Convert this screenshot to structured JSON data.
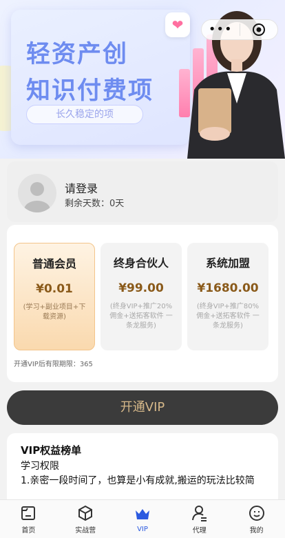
{
  "banner": {
    "line1": "轻资产创",
    "line2": "知识付费项",
    "pill": "长久稳定的项",
    "watermark": "https://www.huzhan.com/ishop52942"
  },
  "user": {
    "name": "请登录",
    "days": "剩余天数：0天"
  },
  "plans": [
    {
      "name": "普通会员",
      "price": "¥0.01",
      "desc": "(学习+副业项目+下载资源)"
    },
    {
      "name": "终身合伙人",
      "price": "¥99.00",
      "desc": "(终身VIP+推广20% 佣金+送拓客软件 一条龙服务)"
    },
    {
      "name": "系统加盟",
      "price": "¥1680.00",
      "desc": "(终身VIP+推广80% 佣金+送拓客软件 一条龙服务)"
    }
  ],
  "plans_limit": "开通VIP后有限期限：365",
  "open_button": "开通VIP",
  "rights": {
    "title": "VIP权益榜单",
    "subtitle": "学习权限",
    "text": "1.亲密一段时间了，也算是小有成就,搬运的玩法比较简"
  },
  "tabs": [
    {
      "label": "首页",
      "icon": "home-icon"
    },
    {
      "label": "实战营",
      "icon": "cube-icon"
    },
    {
      "label": "VIP",
      "icon": "crown-icon"
    },
    {
      "label": "代理",
      "icon": "user-agent-icon"
    },
    {
      "label": "我的",
      "icon": "profile-icon"
    }
  ],
  "colors": {
    "accent": "#2b5ae0",
    "gold": "#8a5a1a",
    "button_bg": "#3b3b3b",
    "button_text": "#d7b98a"
  }
}
